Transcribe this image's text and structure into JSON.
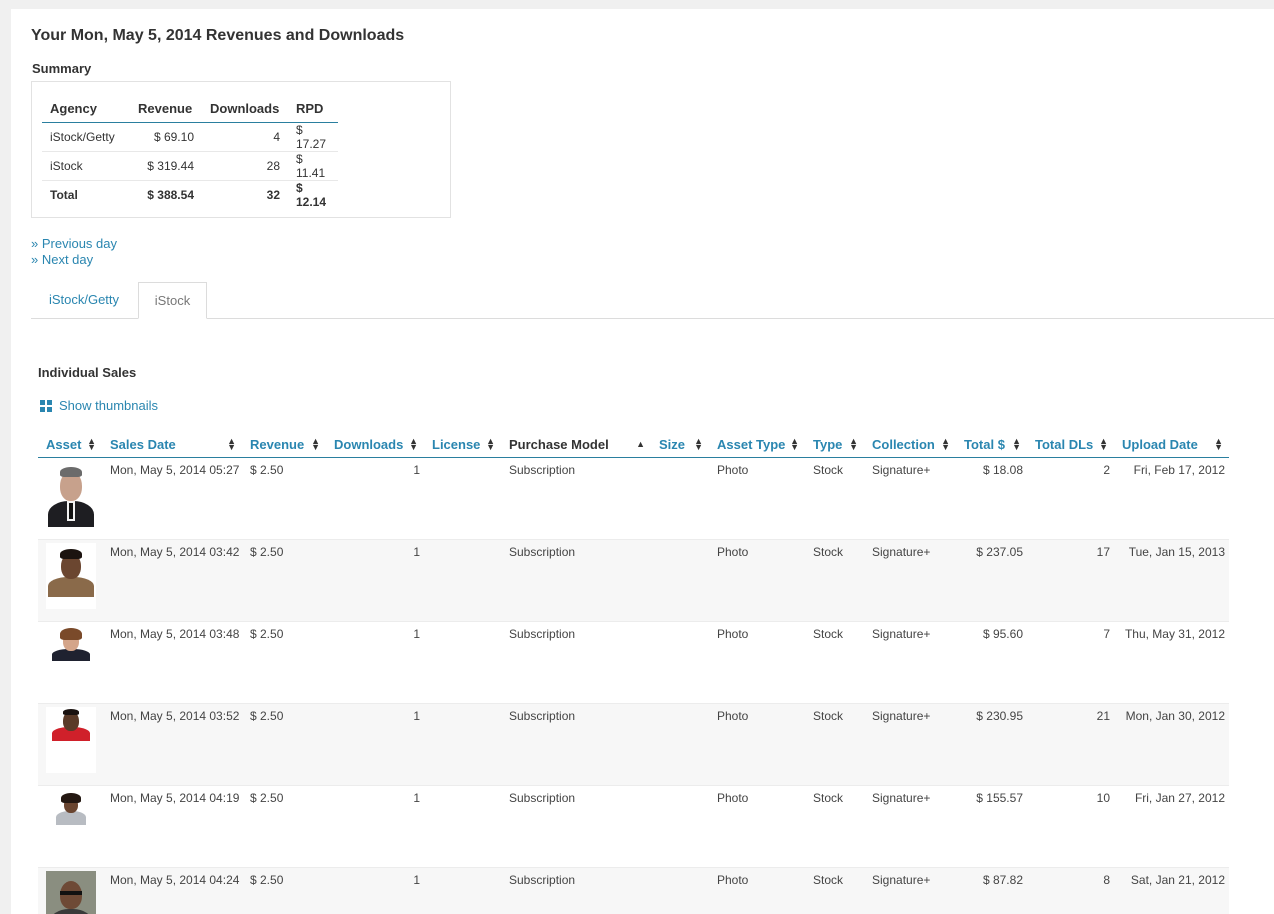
{
  "page": {
    "title": "Your Mon, May 5, 2014 Revenues and Downloads"
  },
  "summary": {
    "heading": "Summary",
    "headers": {
      "agency": "Agency",
      "revenue": "Revenue",
      "downloads": "Downloads",
      "rpd": "RPD"
    },
    "rows": [
      {
        "agency": "iStock/Getty",
        "revenue": "$ 69.10",
        "downloads": "4",
        "rpd": "$ 17.27"
      },
      {
        "agency": "iStock",
        "revenue": "$ 319.44",
        "downloads": "28",
        "rpd": "$ 11.41"
      }
    ],
    "total": {
      "agency": "Total",
      "revenue": "$ 388.54",
      "downloads": "32",
      "rpd": "$ 12.14"
    }
  },
  "nav": {
    "previous": "» Previous day",
    "next": "» Next day"
  },
  "tabs": [
    {
      "label": "iStock/Getty",
      "active": false
    },
    {
      "label": "iStock",
      "active": true
    }
  ],
  "sales": {
    "heading": "Individual Sales",
    "show_thumbnails": "Show thumbnails",
    "columns": {
      "asset": "Asset",
      "sales_date": "Sales Date",
      "revenue": "Revenue",
      "downloads": "Downloads",
      "license": "License",
      "purchase_model": "Purchase Model",
      "size": "Size",
      "asset_type": "Asset Type",
      "type": "Type",
      "collection": "Collection",
      "total_usd": "Total $",
      "total_dls": "Total DLs",
      "upload_date": "Upload Date"
    },
    "rows": [
      {
        "sales_date": "Mon, May 5, 2014 05:27",
        "revenue": "$ 2.50",
        "downloads": "1",
        "license": "",
        "purchase_model": "Subscription",
        "size": "",
        "asset_type": "Photo",
        "type": "Stock",
        "collection": "Signature+",
        "total_usd": "$ 18.08",
        "total_dls": "2",
        "upload_date": "Fri, Feb 17, 2012"
      },
      {
        "sales_date": "Mon, May 5, 2014 03:42",
        "revenue": "$ 2.50",
        "downloads": "1",
        "license": "",
        "purchase_model": "Subscription",
        "size": "",
        "asset_type": "Photo",
        "type": "Stock",
        "collection": "Signature+",
        "total_usd": "$ 237.05",
        "total_dls": "17",
        "upload_date": "Tue, Jan 15, 2013"
      },
      {
        "sales_date": "Mon, May 5, 2014 03:48",
        "revenue": "$ 2.50",
        "downloads": "1",
        "license": "",
        "purchase_model": "Subscription",
        "size": "",
        "asset_type": "Photo",
        "type": "Stock",
        "collection": "Signature+",
        "total_usd": "$ 95.60",
        "total_dls": "7",
        "upload_date": "Thu, May 31, 2012"
      },
      {
        "sales_date": "Mon, May 5, 2014 03:52",
        "revenue": "$ 2.50",
        "downloads": "1",
        "license": "",
        "purchase_model": "Subscription",
        "size": "",
        "asset_type": "Photo",
        "type": "Stock",
        "collection": "Signature+",
        "total_usd": "$ 230.95",
        "total_dls": "21",
        "upload_date": "Mon, Jan 30, 2012"
      },
      {
        "sales_date": "Mon, May 5, 2014 04:19",
        "revenue": "$ 2.50",
        "downloads": "1",
        "license": "",
        "purchase_model": "Subscription",
        "size": "",
        "asset_type": "Photo",
        "type": "Stock",
        "collection": "Signature+",
        "total_usd": "$ 155.57",
        "total_dls": "10",
        "upload_date": "Fri, Jan 27, 2012"
      },
      {
        "sales_date": "Mon, May 5, 2014 04:24",
        "revenue": "$ 2.50",
        "downloads": "1",
        "license": "",
        "purchase_model": "Subscription",
        "size": "",
        "asset_type": "Photo",
        "type": "Stock",
        "collection": "Signature+",
        "total_usd": "$ 87.82",
        "total_dls": "8",
        "upload_date": "Sat, Jan 21, 2012"
      }
    ]
  },
  "colors": {
    "link": "#2a86b0",
    "rule": "#2a7f9f",
    "text": "#333333"
  }
}
